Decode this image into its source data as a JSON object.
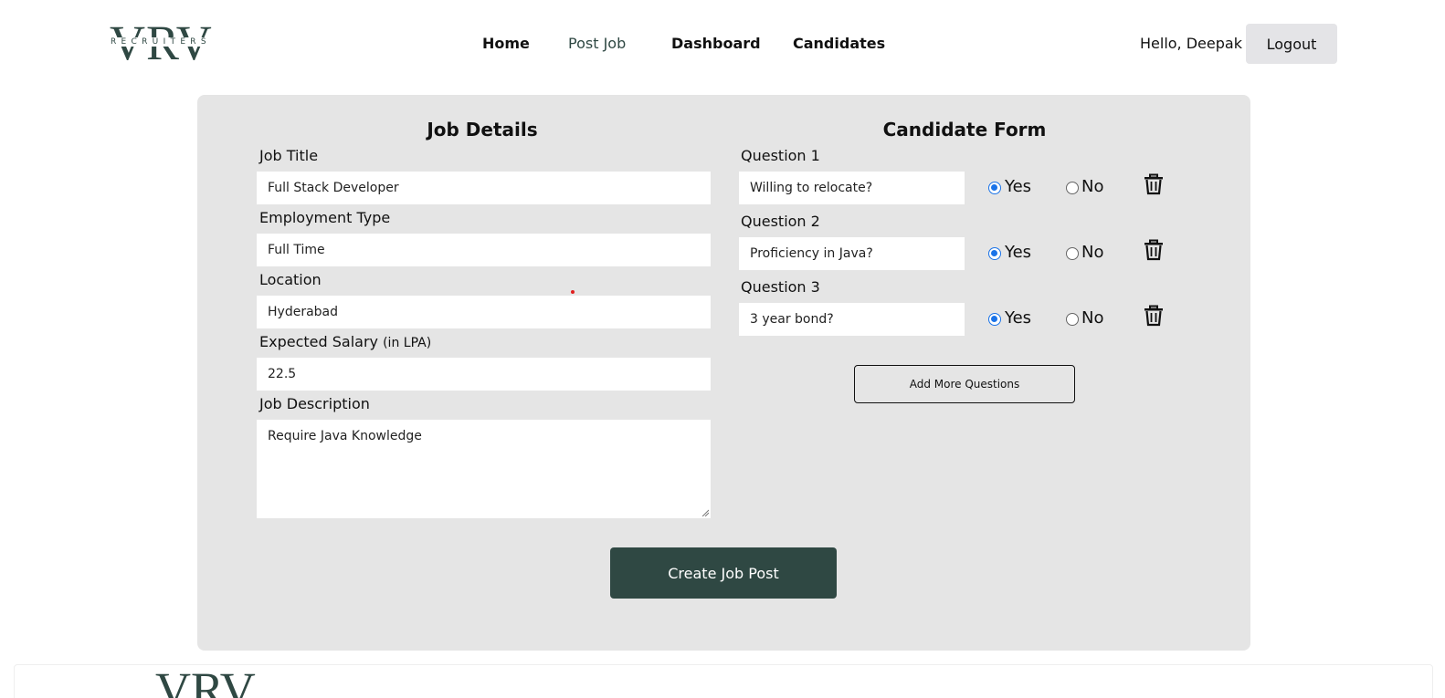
{
  "brand": {
    "logo_main": "VRV",
    "logo_sub": "RECRUITERS",
    "color": "#2f4843"
  },
  "nav": {
    "home": "Home",
    "post_job": "Post Job",
    "dashboard": "Dashboard",
    "candidates": "Candidates"
  },
  "user": {
    "greeting": "Hello, Deepak",
    "logout": "Logout"
  },
  "job_details": {
    "title": "Job Details",
    "job_title_label": "Job Title",
    "job_title_value": "Full Stack Developer",
    "employment_type_label": "Employment Type",
    "employment_type_value": "Full Time",
    "location_label": "Location",
    "location_value": "Hyderabad",
    "salary_label": "Expected Salary",
    "salary_unit": "(in LPA)",
    "salary_value": "22.5",
    "description_label": "Job Description",
    "description_value": "Require Java Knowledge"
  },
  "candidate_form": {
    "title": "Candidate Form",
    "questions": [
      {
        "label": "Question 1",
        "value": "Willing to relocate?",
        "yes": "Yes",
        "no": "No",
        "selected": "Yes"
      },
      {
        "label": "Question 2",
        "value": "Proficiency in Java?",
        "yes": "Yes",
        "no": "No",
        "selected": "Yes"
      },
      {
        "label": "Question 3",
        "value": "3 year bond?",
        "yes": "Yes",
        "no": "No",
        "selected": "Yes"
      }
    ],
    "add_more": "Add More Questions"
  },
  "submit": {
    "label": "Create Job Post"
  },
  "colors": {
    "accent": "#2f4843",
    "card_bg": "#e5e5e5",
    "radio": "#1a73e8"
  }
}
